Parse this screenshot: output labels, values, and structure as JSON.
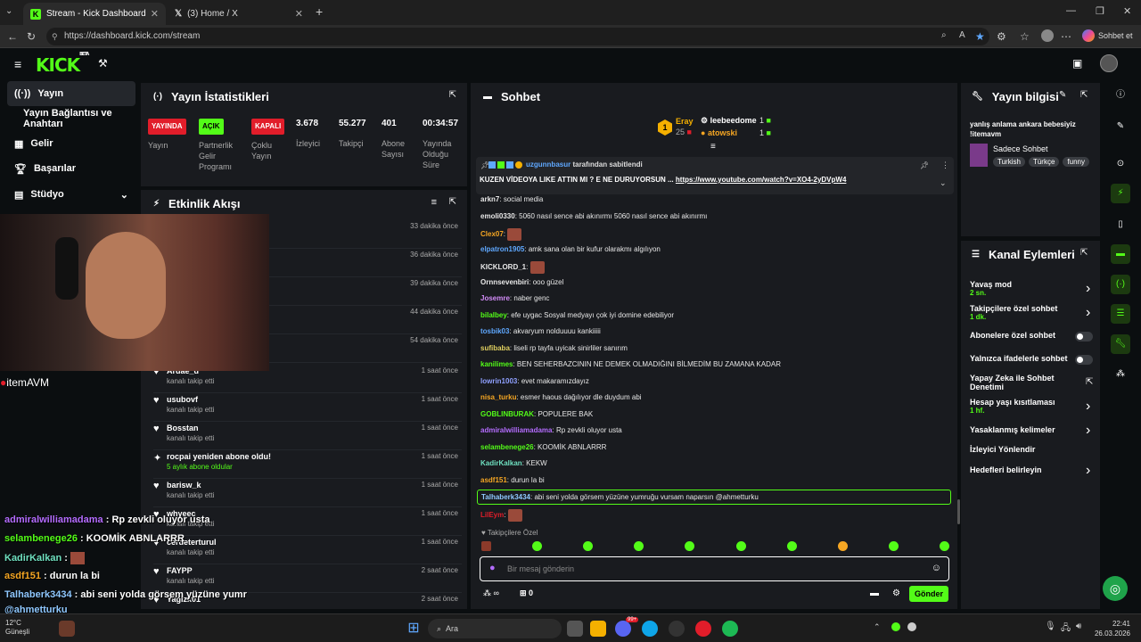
{
  "browser": {
    "tabs": [
      {
        "title": "Stream - Kick Dashboard",
        "active": true
      },
      {
        "title": "(3) Home / X",
        "active": false
      }
    ],
    "url": "https://dashboard.kick.com/stream",
    "copilot_label": "Sohbet et"
  },
  "header": {
    "logo": "KICK",
    "logo_tag": "BETA"
  },
  "sidebar": {
    "items": [
      {
        "label": "Yayın",
        "icon": "broadcast-icon"
      },
      {
        "label": "Yayın Bağlantısı ve Anahtarı",
        "icon": ""
      },
      {
        "label": "Gelir",
        "icon": "chart-icon"
      },
      {
        "label": "Başarılar",
        "icon": "trophy-icon"
      },
      {
        "label": "Stüdyo",
        "icon": "studio-icon"
      }
    ]
  },
  "stats": {
    "title": "Yayın İstatistikleri",
    "items": [
      {
        "badge": "YAYINDA",
        "badge_color": "#e11d2a",
        "label": "Yayın"
      },
      {
        "badge": "AÇIK",
        "badge_color": "#53fc18",
        "label": "Partnerlik Gelir Programı"
      },
      {
        "badge": "KAPALI",
        "badge_color": "#e11d2a",
        "label": "Çoklu Yayın"
      },
      {
        "value": "3.678",
        "label": "İzleyici"
      },
      {
        "value": "55.277",
        "label": "Takipçi"
      },
      {
        "value": "401",
        "label": "Abone Sayısı"
      },
      {
        "value": "00:34:57",
        "label": "Yayında Olduğu Süre"
      }
    ]
  },
  "activity": {
    "title": "Etkinlik Akışı",
    "hidden_rows": [
      {
        "time": "33 dakika önce"
      },
      {
        "time": "36 dakika önce"
      },
      {
        "time": "39 dakika önce"
      },
      {
        "time": "44 dakika önce"
      },
      {
        "time": "54 dakika önce"
      }
    ],
    "rows": [
      {
        "name": "Ardae_d",
        "sub": "kanalı takip etti",
        "time": "1 saat önce",
        "icon": "heart-icon"
      },
      {
        "name": "usubovf",
        "sub": "kanalı takip etti",
        "time": "1 saat önce",
        "icon": "heart-icon"
      },
      {
        "name": "Bosstan",
        "sub": "kanalı takip etti",
        "time": "1 saat önce",
        "icon": "heart-icon"
      },
      {
        "name": "rocpai yeniden abone oldu!",
        "sub": "5 aylık abone oldular",
        "time": "1 saat önce",
        "icon": "sparkle-icon"
      },
      {
        "name": "barisw_k",
        "sub": "kanalı takip etti",
        "time": "1 saat önce",
        "icon": "heart-icon"
      },
      {
        "name": "whyeec",
        "sub": "kanalı takip etti",
        "time": "1 saat önce",
        "icon": "heart-icon"
      },
      {
        "name": "cerdeterturul",
        "sub": "kanalı takip etti",
        "time": "1 saat önce",
        "icon": "heart-icon"
      },
      {
        "name": "FAYPP",
        "sub": "kanalı takip etti",
        "time": "2 saat önce",
        "icon": "heart-icon"
      },
      {
        "name": "Yagizx01",
        "sub": "",
        "time": "2 saat önce",
        "icon": "heart-icon"
      }
    ]
  },
  "chat": {
    "title": "Sohbet",
    "leaderboard": {
      "top_rank": "1",
      "top_name": "Eray",
      "top_score": "25",
      "entries": [
        {
          "name": "leebeedome",
          "count": "1"
        },
        {
          "name": "atowski",
          "count": "1"
        }
      ]
    },
    "pinned": {
      "by_user": "uzgunnbasur",
      "by_text": "tarafından sabitlendi",
      "text": "KUZEN VİDEOYA LIKE ATTIN MI ? E NE DURUYORSUN ...",
      "link": "https://www.youtube.com/watch?v=XO4-2yDVpW4"
    },
    "messages": [
      {
        "user": "arkn7",
        "color": "#e8e8e8",
        "text": "social media"
      },
      {
        "user": "emoli0330",
        "color": "#e8e8e8",
        "text": "5060 nasıl sence abi akınırmı 5060 nasıl sence abi akınırmı"
      },
      {
        "user": "Clex07",
        "color": "#f5a623",
        "text": ""
      },
      {
        "user": "elpatron1905",
        "color": "#5fa8ff",
        "text": "amk sana olan bir kufur olarakmı algılıyon"
      },
      {
        "user": "KICKLORD_1",
        "color": "#e8e8e8",
        "text": ""
      },
      {
        "user": "Ornnsevenbiri",
        "color": "#e8e8e8",
        "text": "ooo güzel"
      },
      {
        "user": "Josemre",
        "color": "#d38cf8",
        "text": "naber genc"
      },
      {
        "user": "bilalbey",
        "color": "#53fc18",
        "text": "efe uygac Sosyal medyayı çok iyi domine edebiliyor"
      },
      {
        "user": "tosbik03",
        "color": "#5fa8ff",
        "text": "akvaryum nolduuuu kankiiiii"
      },
      {
        "user": "sufibaba",
        "color": "#e0d060",
        "text": "liseli rp tayfa uyicak sinirliler sanırım"
      },
      {
        "user": "kanilimes",
        "color": "#53fc18",
        "text": "BEN SEHERBAZCININ NE DEMEK OLMADIĞINI BİLMEDİM BU ZAMANA KADAR"
      },
      {
        "user": "lowrin1003",
        "color": "#8fa0ff",
        "text": "evet makaramızdayız"
      },
      {
        "user": "nisa_turku",
        "color": "#f5a623",
        "text": "esmer haous dağılıyor dle duydum abi"
      },
      {
        "user": "GOBLINBURAK",
        "color": "#53fc18",
        "text": "POPULERE BAK"
      },
      {
        "user": "admiralwilliamadama",
        "color": "#b46cff",
        "text": "Rp zevkli oluyor usta"
      },
      {
        "user": "selambenege26",
        "color": "#53fc18",
        "text": "KOOMİK ABNLARRR"
      },
      {
        "user": "KadirKalkan",
        "color": "#6fe0c0",
        "text": "KEKW"
      },
      {
        "user": "asdf151",
        "color": "#f5a623",
        "text": "durun la bi"
      },
      {
        "user": "Talhaberk3434",
        "color": "#8fc8ff",
        "text": "abi seni yolda görsem yüzüne yumruğu vursam naparsın @ahmetturku"
      },
      {
        "user": "LilEym",
        "color": "#e11d2a",
        "text": ""
      }
    ],
    "followers_only": "Takipçilere Özel",
    "input_placeholder": "Bir mesaj gönderin",
    "viewers_infinity": "∞",
    "gift_count": "0",
    "send_label": "Gönder"
  },
  "stream_info": {
    "title": "Yayın bilgisi",
    "stream_title": "yanlış anlama ankara bebesiyiz !itemavm",
    "category": "Sadece Sohbet",
    "tags": [
      "Turkish",
      "Türkçe",
      "funny"
    ]
  },
  "channel_actions": {
    "title": "Kanal Eylemleri",
    "items": [
      {
        "label": "Yavaş mod",
        "sub": "2 sn.",
        "control": "chevron"
      },
      {
        "label": "Takipçilere özel sohbet",
        "sub": "1 dk.",
        "control": "chevron"
      },
      {
        "label": "Abonelere özel sohbet",
        "sub": "",
        "control": "toggle"
      },
      {
        "label": "Yalnızca ifadelerle sohbet",
        "sub": "",
        "control": "toggle"
      },
      {
        "label": "Yapay Zeka ile Sohbet Denetimi",
        "sub": "",
        "control": "external"
      },
      {
        "label": "Hesap yaşı kısıtlaması",
        "sub": "1 hf.",
        "control": "chevron"
      },
      {
        "label": "Yasaklanmış kelimeler",
        "sub": "",
        "control": "chevron"
      },
      {
        "label": "İzleyici Yönlendir",
        "sub": "",
        "control": "none"
      },
      {
        "label": "Hedefleri belirleyin",
        "sub": "",
        "control": "chevron"
      }
    ]
  },
  "overlay": {
    "brand": "itemAVM",
    "lines": [
      {
        "user": "admiralwilliamadama",
        "color": "#b46cff",
        "text": "Rp zevkli oluyor usta"
      },
      {
        "user": "selambenege26",
        "color": "#53fc18",
        "text": "KOOMİK ABNLARRR"
      },
      {
        "user": "KadirKalkan",
        "color": "#6fe0c0",
        "text": ""
      },
      {
        "user": "asdf151",
        "color": "#f5a623",
        "text": "durun la bi"
      },
      {
        "user": "Talhaberk3434",
        "color": "#8fc8ff",
        "text": "abi seni yolda görsem yüzüne yumr"
      },
      {
        "user": "",
        "color": "#8fc8ff",
        "text": "@ahmetturku"
      }
    ]
  },
  "taskbar": {
    "weather_temp": "12°C",
    "weather_label": "Güneşli",
    "search_label": "Ara",
    "time": "22:41",
    "date": "26.03.2026",
    "notif_badge": "99+"
  }
}
